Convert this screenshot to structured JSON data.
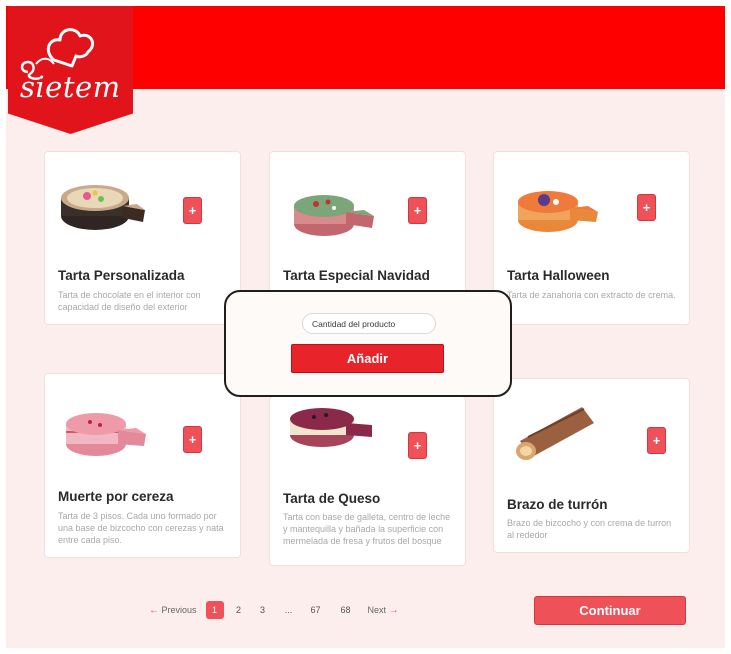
{
  "brand": {
    "name": "sietem",
    "primary_color": "#fe0000",
    "accent_color": "#ee5158",
    "background_color": "#fdeeee"
  },
  "products": [
    {
      "title": "Tarta Personalizada",
      "description": "Tarta de chocolate en el interior con capacidad de diseño del exterior",
      "add_label": "+",
      "image": "chocolate-cake"
    },
    {
      "title": "Tarta Especial Navidad",
      "description": "",
      "add_label": "+",
      "image": "christmas-cake"
    },
    {
      "title": "Tarta Halloween",
      "description": "Tarta de zanahoria con extracto de crema.",
      "add_label": "+",
      "image": "halloween-cake"
    },
    {
      "title": "Muerte por cereza",
      "description": "Tarta de 3 pisos. Cada uno formado por una base de bizcocho con cerezas y nata entre cada piso.",
      "add_label": "+",
      "image": "cherry-cake"
    },
    {
      "title": "Tarta de Queso",
      "description": "Tarta con base de galleta, centro de leche y mantequilla y bañada la superficie con mermelada de fresa y frutos del bosque",
      "add_label": "+",
      "image": "cheesecake"
    },
    {
      "title": "Brazo de turrón",
      "description": "Brazo de bizcocho y con crema de turron al rededor",
      "add_label": "+",
      "image": "roll-cake"
    }
  ],
  "modal": {
    "quantity_placeholder": "Cantidad del producto",
    "add_label": "Añadir"
  },
  "pagination": {
    "previous_label": "Previous",
    "next_label": "Next",
    "pages": [
      "1",
      "2",
      "3",
      "...",
      "67",
      "68"
    ],
    "current": "1"
  },
  "continue_label": "Continuar"
}
